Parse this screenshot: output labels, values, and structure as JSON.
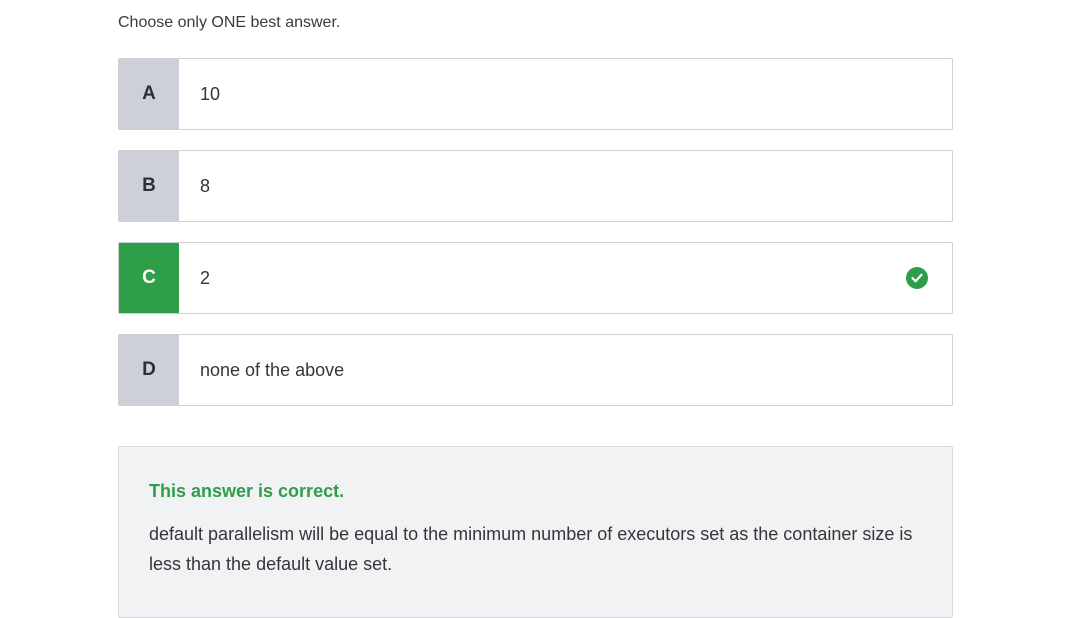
{
  "instruction": "Choose only ONE best answer.",
  "options": [
    {
      "letter": "A",
      "text": "10",
      "correct": false
    },
    {
      "letter": "B",
      "text": "8",
      "correct": false
    },
    {
      "letter": "C",
      "text": "2",
      "correct": true
    },
    {
      "letter": "D",
      "text": "none of the above",
      "correct": false
    }
  ],
  "feedback": {
    "title": "This answer is correct.",
    "explanation": "default parallelism will be equal to the minimum number of executors set as the container size is less than the default value set."
  },
  "colors": {
    "correct": "#2e9e49",
    "letter_bg": "#cdd0d9",
    "feedback_bg": "#f1f2f3"
  },
  "icons": {
    "correct_marker": "check-circle-icon"
  }
}
